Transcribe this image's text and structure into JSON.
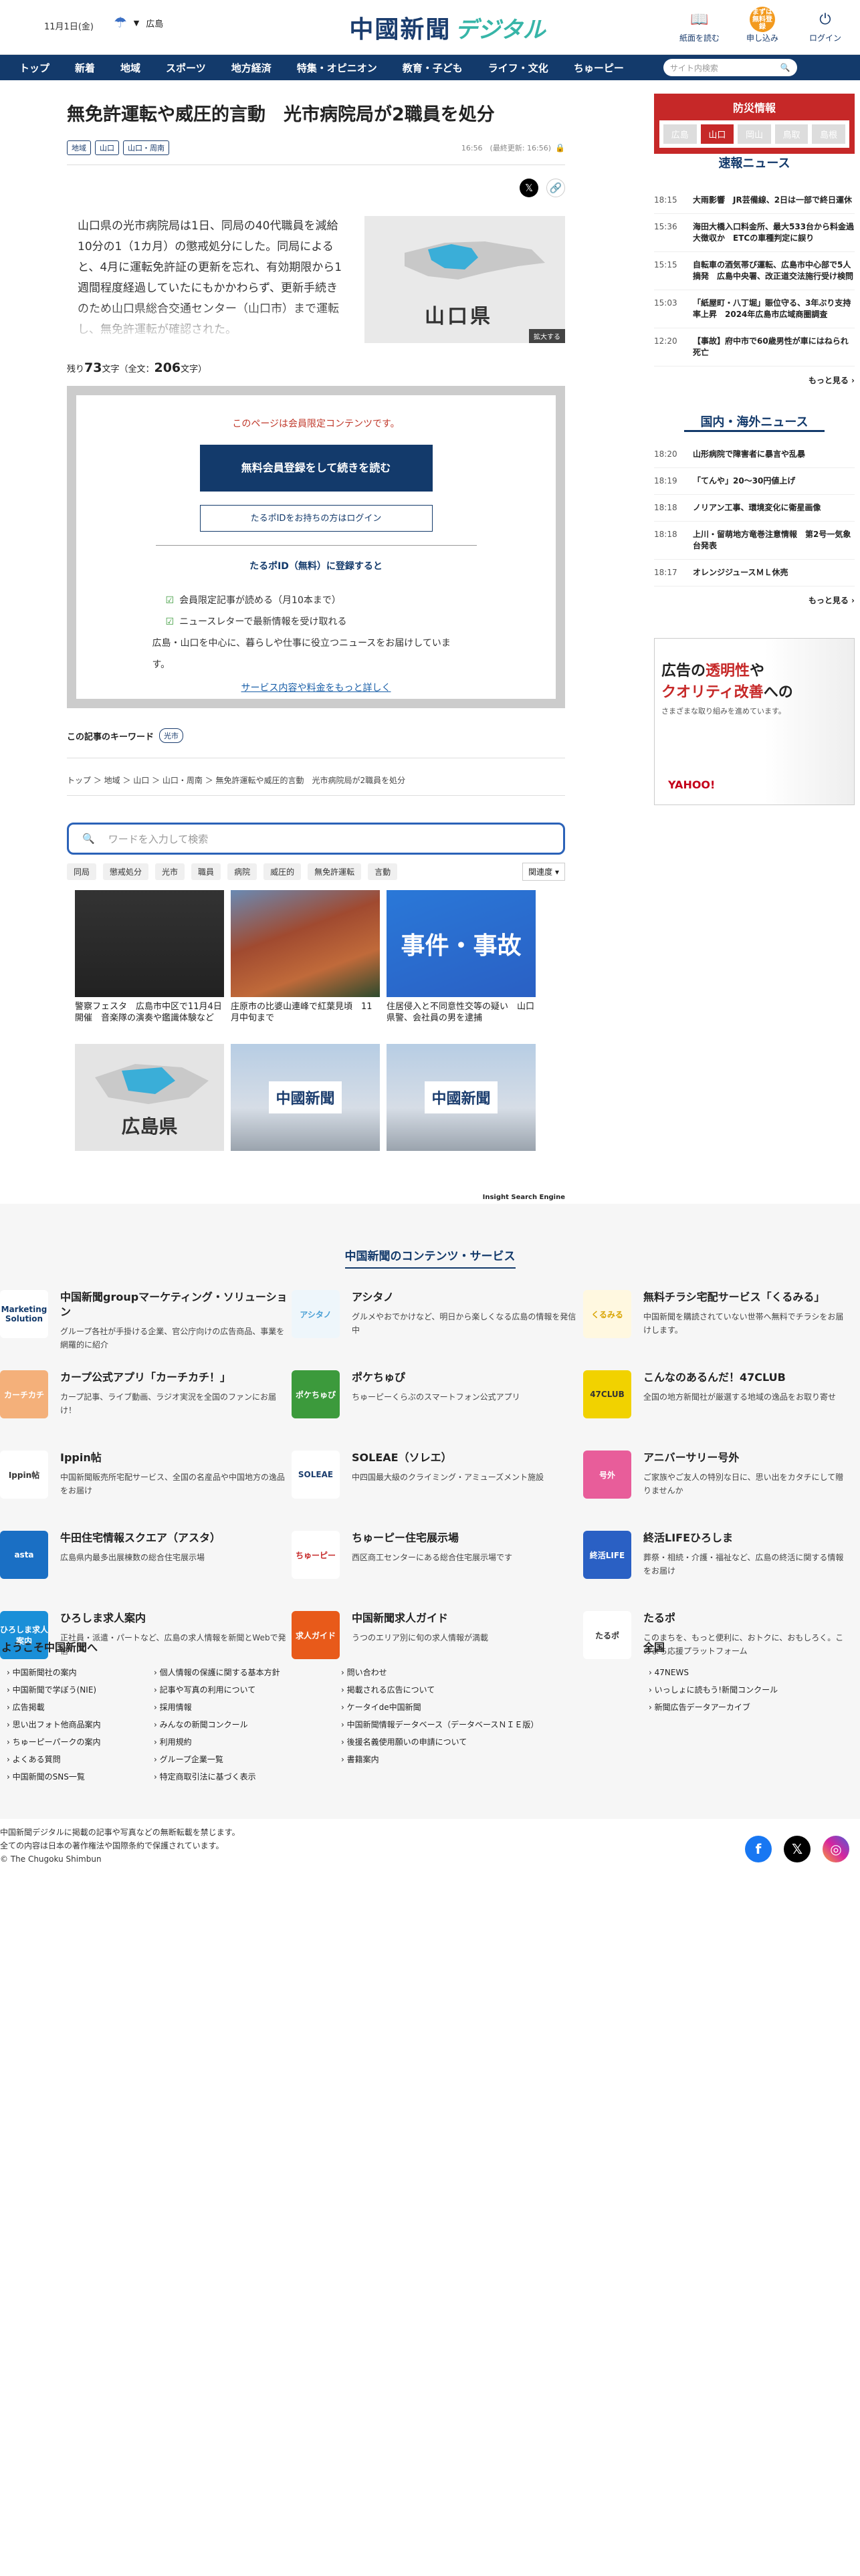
{
  "header": {
    "date": "11月1日(金)",
    "weather_region": "広島",
    "logo_main": "中國新聞",
    "logo_sub": "デジタル",
    "buttons": [
      "紙面を読む",
      "申し込み",
      "ログイン"
    ],
    "apply_icon_text": "まずは無料登録"
  },
  "nav": {
    "items": [
      "トップ",
      "新着",
      "地域",
      "スポーツ",
      "地方経済",
      "特集・オピニオン",
      "教育・子ども",
      "ライフ・文化",
      "ちゅーピー"
    ],
    "search_placeholder": "サイト内検索"
  },
  "article": {
    "title": "無免許運転や威圧的言動　光市病院局が2職員を処分",
    "tags": [
      "地域",
      "山口",
      "山口・周南"
    ],
    "meta": "16:56　(最終更新: 16:56)",
    "lead": "山口県の光市病院局は1日、同局の40代職員を減給10分の1（1カ月）の懲戒処分にした。同局によると、4月に運転免許証の更新を忘れ、有効期限から1週間程度経過していたにもかかわらず、更新手続きのため山口県総合交通センター（山口市）まで運転し、無免許運転が確認された。",
    "map_label": "山口県",
    "map_zoom": "拡大する",
    "remain_prefix": "残り",
    "remain_count": "73",
    "remain_mid": "文字（全文：",
    "total_count": "206",
    "remain_suffix": "文字）"
  },
  "paywall": {
    "note": "このページは会員限定コンテンツです。",
    "cta": "無料会員登録をして続きを読む",
    "login": "たるポIDをお持ちの方はログイン",
    "title": "たるポID（無料）に登録すると",
    "benefit1": "会員限定記事が読める（月10本まで）",
    "benefit2": "ニュースレターで最新情報を受け取れる",
    "benefit3": "広島・山口を中心に、暮らしや仕事に役立つニュースをお届けしています。",
    "more": "サービス内容や料金をもっと詳しく"
  },
  "keywords": {
    "label": "この記事のキーワード",
    "tag": "光市"
  },
  "breadcrumb": "トップ ＞ 地域 ＞ 山口 ＞ 山口・周南 ＞ 無免許運転や威圧的言動　光市病院局が2職員を処分",
  "search": {
    "placeholder": "ワードを入力して検索",
    "chips": [
      "同局",
      "懲戒処分",
      "光市",
      "職員",
      "病院",
      "威圧的",
      "無免許運転",
      "言動"
    ],
    "sort": "関連度"
  },
  "related": [
    {
      "title": "警察フェスタ　広島市中区で11月4日開催　音楽隊の演奏や鑑識体験など",
      "img": "festa"
    },
    {
      "title": "庄原市の比婆山連峰で紅葉見頃　11月中旬まで",
      "img": "forest"
    },
    {
      "title": "住居侵入と不同意性交等の疑い　山口県警、会社員の男を逮捕",
      "img": "jiken",
      "label": "事件・事故"
    },
    {
      "title": "",
      "img": "hiro",
      "label": "広島県"
    },
    {
      "title": "",
      "img": "cg",
      "label": "中國新聞"
    },
    {
      "title": "",
      "img": "cg",
      "label": "中國新聞"
    }
  ],
  "ise": "Insight Search Engine",
  "sidebar": {
    "bousai_title": "防災情報",
    "bousai_regions": [
      "広島",
      "山口",
      "岡山",
      "鳥取",
      "島根"
    ],
    "sokuho_title": "速報ニュース",
    "sokuho": [
      {
        "time": "18:15",
        "text": "大雨影響　JR芸備線、2日は一部で終日運休"
      },
      {
        "time": "15:36",
        "text": "海田大橋入口料金所、最大533台から料金過大徴収か　ETCの車種判定に誤り"
      },
      {
        "time": "15:15",
        "text": "自転車の酒気帯び運転、広島市中心部で5人摘発　広島中央署、改正道交法施行受け検問"
      },
      {
        "time": "15:03",
        "text": "「紙屋町・八丁堀」賑位守る、3年ぶり支持率上昇　2024年広島市広域商圏調査"
      },
      {
        "time": "12:20",
        "text": "【事故】府中市で60歳男性が車にはねられ死亡"
      }
    ],
    "more": "もっと見る ›",
    "kokunai_title": "国内・海外ニュース",
    "kokunai": [
      {
        "time": "18:20",
        "text": "山形病院で障害者に暴言や乱暴"
      },
      {
        "time": "18:19",
        "text": "「てんや」20～30円値上げ"
      },
      {
        "time": "18:18",
        "text": "ノリアン工事、環境変化に衛星画像"
      },
      {
        "time": "18:18",
        "text": "上川・留萌地方竜巻注意情報　第2号一気象台発表"
      },
      {
        "time": "18:17",
        "text": "オレンジジュースＭＬ休売"
      }
    ],
    "ad_line1a": "広告の",
    "ad_line1b": "透明性",
    "ad_line1c": "や",
    "ad_line2a": "クオリティ改善",
    "ad_line2b": "への",
    "ad_line3": "さまざまな取り組みを進めています。",
    "ad_brand": "YAHOO!"
  },
  "contents": {
    "title": "中国新聞のコンテンツ・サービス",
    "items": [
      {
        "name": "中国新聞groupマーケティング・ソリューション",
        "desc": "グループ各社が手掛ける企業、官公庁向けの広告商品、事業を網羅的に紹介",
        "logo": "Marketing Solution",
        "color": "#ffffff",
        "fg": "#133a6b"
      },
      {
        "name": "アシタノ",
        "desc": "グルメやおでかけなど、明日から楽しくなる広島の情報を発信中",
        "logo": "アシタノ",
        "color": "#eef6fb",
        "fg": "#4aa0d5"
      },
      {
        "name": "無料チラシ宅配サービス「くるみる」",
        "desc": "中国新聞を購読されていない世帯へ無料でチラシをお届けします。",
        "logo": "くるみる",
        "color": "#fff8e0",
        "fg": "#d8a400"
      },
      {
        "name": "カープ公式アプリ「カーチカチ！」",
        "desc": "カープ記事、ライブ動画、ラジオ実況を全国のファンにお届け！",
        "logo": "カーチカチ",
        "color": "#f4b07a",
        "fg": "#ffffff"
      },
      {
        "name": "ポケちゅぴ",
        "desc": "ちゅーピーくらぶのスマートフォン公式アプリ",
        "logo": "ポケちゅぴ",
        "color": "#3c9a3c",
        "fg": "#ffffff"
      },
      {
        "name": "こんなのあるんだ！47CLUB",
        "desc": "全国の地方新聞社が厳選する地域の逸品をお取り寄せ",
        "logo": "47CLUB",
        "color": "#f1d200",
        "fg": "#333333"
      },
      {
        "name": "Ippin帖",
        "desc": "中国新聞販売所宅配サービス、全国の名産品や中国地方の逸品をお届け",
        "logo": "Ippin帖",
        "color": "#ffffff",
        "fg": "#333333"
      },
      {
        "name": "SOLEAE（ソレエ）",
        "desc": "中四国最大級のクライミング・アミューズメント施設",
        "logo": "SOLEAE",
        "color": "#ffffff",
        "fg": "#1b3d6e"
      },
      {
        "name": "アニバーサリー号外",
        "desc": "ご家族やご友人の特別な日に、思い出をカタチにして贈りませんか",
        "logo": "号外",
        "color": "#e85d9a",
        "fg": "#ffffff"
      },
      {
        "name": "牛田住宅情報スクエア（アスタ）",
        "desc": "広島県内最多出展棟数の総合住宅展示場",
        "logo": "asta",
        "color": "#1a6fc4",
        "fg": "#ffffff"
      },
      {
        "name": "ちゅーピー住宅展示場",
        "desc": "西区商工センターにある総合住宅展示場です",
        "logo": "ちゅーピー",
        "color": "#ffffff",
        "fg": "#c62828"
      },
      {
        "name": "終活LIFEひろしま",
        "desc": "葬祭・相続・介護・福祉など、広島の終活に関する情報をお届け",
        "logo": "終活LIFE",
        "color": "#2a60c4",
        "fg": "#ffffff"
      },
      {
        "name": "ひろしま求人案内",
        "desc": "正社員・派遣・パートなど、広島の求人情報を新聞とWebで発信",
        "logo": "ひろしま求人案内",
        "color": "#1a8fd8",
        "fg": "#ffffff"
      },
      {
        "name": "中国新聞求人ガイド",
        "desc": "うつのエリア別に旬の求人情報が満載",
        "logo": "求人ガイド",
        "color": "#e85a1a",
        "fg": "#ffffff"
      },
      {
        "name": "たるポ",
        "desc": "このまちを、もっと便利に、おトクに、おもしろく。このまち応援プラットフォーム",
        "logo": "たるポ",
        "color": "#ffffff",
        "fg": "#333333"
      }
    ]
  },
  "welcome": {
    "title": "ようこそ中国新聞へ",
    "col1": [
      "中国新聞社の案内",
      "中国新聞で学ぼう(NIE)",
      "広告掲載",
      "思い出フォト他商品案内",
      "ちゅーピーパークの案内",
      "よくある質問",
      "中国新聞のSNS一覧"
    ],
    "col2": [
      "個人情報の保護に関する基本方針",
      "記事や写真の利用について",
      "採用情報",
      "みんなの新聞コンクール",
      "利用規約",
      "グループ企業一覧",
      "特定商取引法に基づく表示"
    ],
    "col3": [
      "問い合わせ",
      "掲載される広告について",
      "ケータイde中国新聞",
      "中国新聞情報データベース（データベースＮＩＥ版）",
      "後援名義使用願いの申請について",
      "書籍案内"
    ],
    "zenkoku_title": "全国",
    "zenkoku": [
      "47NEWS",
      "いっしょに読もう!新聞コンクール",
      "新聞広告データアーカイブ"
    ]
  },
  "footer": {
    "line1": "中国新聞デジタルに掲載の記事や写真などの無断転載を禁じます。",
    "line2": "全ての内容は日本の著作権法や国際条約で保護されています。",
    "line3": "© The Chugoku Shimbun"
  }
}
